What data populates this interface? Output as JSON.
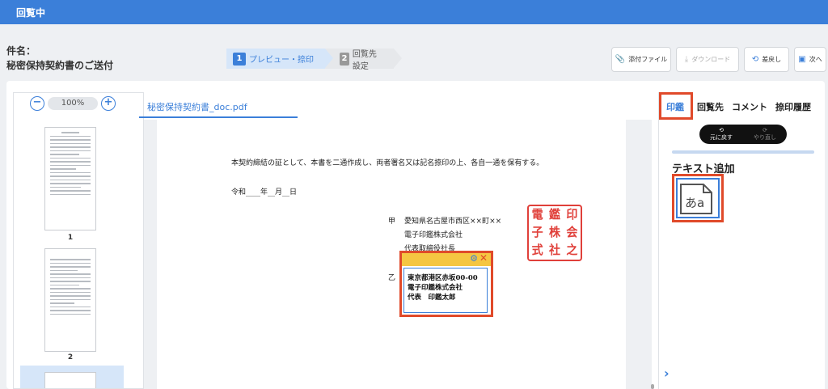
{
  "app": {
    "title": "回覧中"
  },
  "subject": {
    "label": "件名：",
    "value": "秘密保持契約書のご送付"
  },
  "steps": [
    {
      "num": "1",
      "label": "プレビュー・捺印"
    },
    {
      "num": "2",
      "label": "回覧先設定"
    }
  ],
  "toolbar": {
    "attach": "添付ファイル",
    "download": "ダウンロード",
    "return": "差戻し",
    "next": "次へ"
  },
  "zoom": {
    "minus": "−",
    "value": "100%",
    "plus": "+"
  },
  "thumbnails": [
    {
      "num": "1"
    },
    {
      "num": "2"
    }
  ],
  "document": {
    "tab": "秘密保持契約書_doc.pdf",
    "lines": {
      "conclusion": "本契約締結の証として、本書を二通作成し、両者署名又は記名捺印の上、各自一通を保有する。",
      "date": "令和____年__月__日",
      "party_a_mark": "甲",
      "party_a_address": "愛知県名古屋市西区××町××",
      "party_a_company": "電子印鑑株式会社",
      "party_a_rep": "代表取締役社長",
      "party_b_mark": "乙"
    },
    "seal_chars": [
      "電",
      "鑑",
      "印",
      "子",
      "株",
      "会",
      "式",
      "社",
      "之"
    ],
    "stamp": {
      "line1": "東京都港区赤坂00-00",
      "line2": "電子印鑑株式会社",
      "line3": "代表　印鑑太郎"
    }
  },
  "right_panel": {
    "tabs": [
      "印鑑",
      "回覧先",
      "コメント",
      "捺印履歴"
    ],
    "undo": "元に戻す",
    "redo": "やり直し",
    "add_text_title": "テキスト追加",
    "add_text_glyph": "あa"
  },
  "colors": {
    "primary": "#3b7fd9",
    "highlight": "#e04a2a",
    "seal": "#e0403a",
    "stamp_bar": "#f5c642"
  }
}
